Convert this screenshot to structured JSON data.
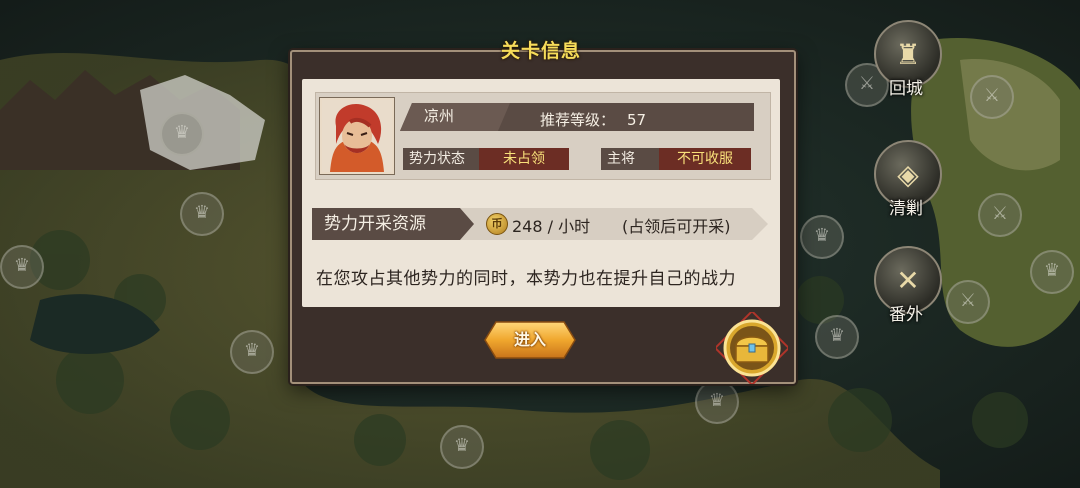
{
  "dialog": {
    "title": "关卡信息",
    "region": "凉州",
    "recommended_level_label": "推荐等级：",
    "recommended_level": "57",
    "status_label": "势力状态",
    "status_value": "未占领",
    "general_label": "主将",
    "general_value": "不可收服",
    "resource_label": "势力开采资源",
    "resource_rate": "248 / 小时",
    "resource_note": "(占领后可开采)",
    "description": "在您攻占其他势力的同时，本势力也在提升自己的战力",
    "enter_label": "进入"
  },
  "side_buttons": [
    {
      "label": "回城",
      "icon": "castle-icon"
    },
    {
      "label": "清剿",
      "icon": "treasure-pile-icon"
    },
    {
      "label": "番外",
      "icon": "scroll-map-icon"
    }
  ],
  "colors": {
    "title": "#f6dc5a",
    "status_value": "#f8e07a",
    "enter_button": "#e9a326"
  }
}
